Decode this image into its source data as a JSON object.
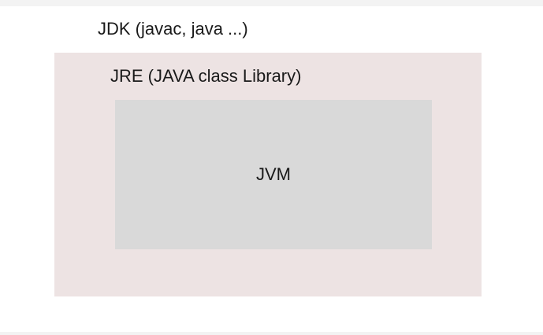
{
  "diagram": {
    "jdk": {
      "label": "JDK (javac, java ...)"
    },
    "jre": {
      "label": "JRE (JAVA class Library)",
      "fill": "#ede3e3"
    },
    "jvm": {
      "label": "JVM",
      "fill": "#d9d9d9"
    }
  }
}
